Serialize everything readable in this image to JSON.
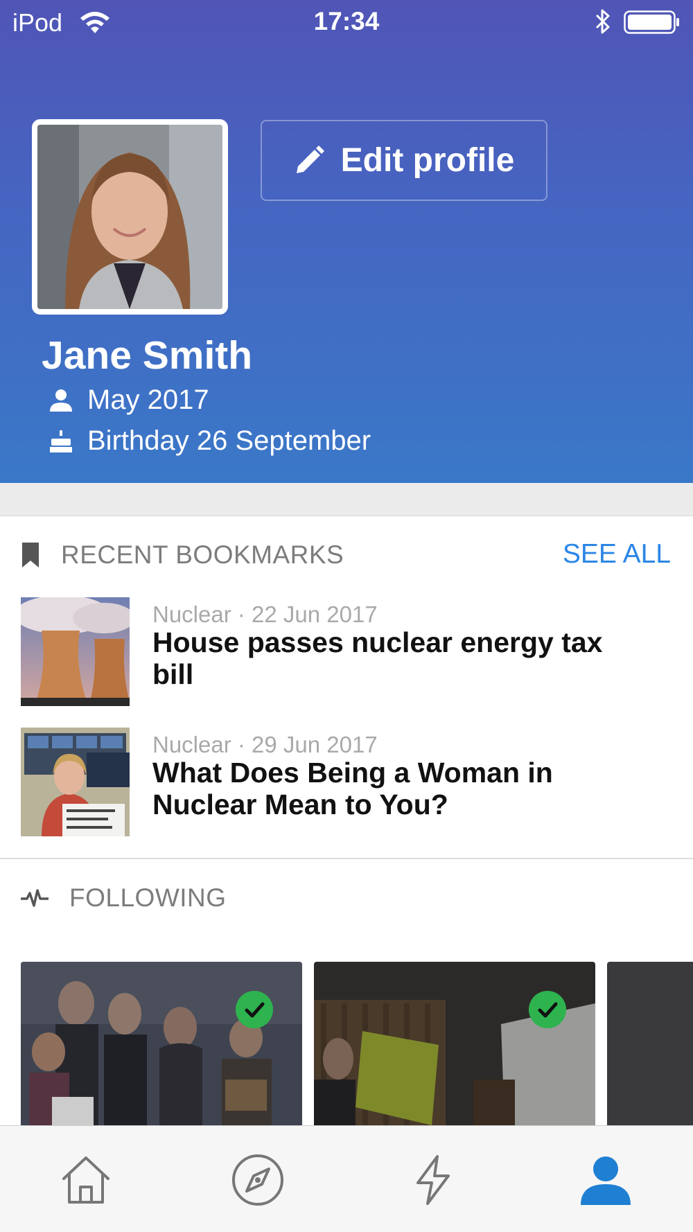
{
  "status_bar": {
    "carrier": "iPod",
    "time": "17:34"
  },
  "profile": {
    "edit_label": "Edit profile",
    "name": "Jane Smith",
    "joined": "May 2017",
    "birthday": "Birthday 26 September"
  },
  "bookmarks": {
    "heading": "RECENT BOOKMARKS",
    "see_all": "SEE ALL",
    "items": [
      {
        "kicker": "Nuclear · 22 Jun 2017",
        "title": "House passes nuclear energy tax bill"
      },
      {
        "kicker": "Nuclear · 29 Jun 2017",
        "title": "What Does Being a Woman in Nuclear Mean to You?"
      }
    ]
  },
  "following": {
    "heading": "FOLLOWING"
  },
  "tabbar": {
    "items": [
      "home-icon",
      "compass-icon",
      "lightning-icon",
      "person-icon"
    ],
    "active": "person-icon"
  },
  "colors": {
    "header_top": "#5055b6",
    "header_bottom": "#3a78c8",
    "accent": "#2b86e6",
    "check_green": "#2eb34f",
    "tab_active": "#1e7fd3"
  }
}
